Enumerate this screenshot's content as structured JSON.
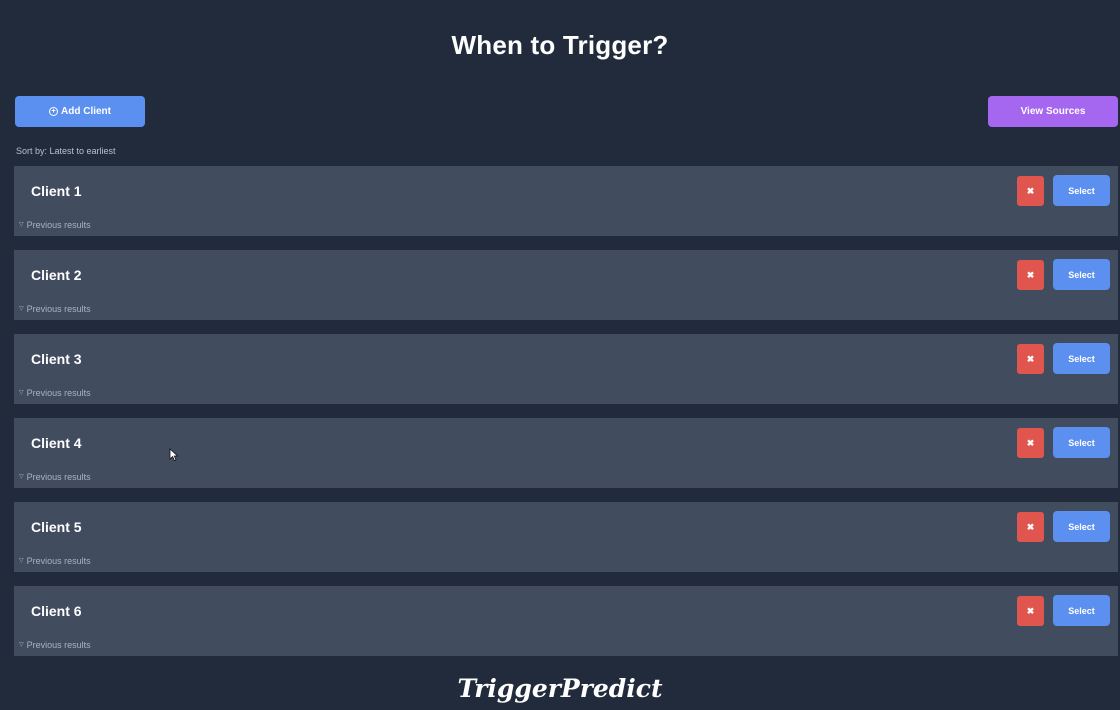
{
  "page": {
    "title": "When to Trigger?",
    "brand": "TriggerPredict"
  },
  "toolbar": {
    "add_client_label": "Add Client",
    "add_client_icon": "plus-circle-icon",
    "view_sources_label": "View Sources"
  },
  "sort": {
    "label": "Sort by: Latest to earliest"
  },
  "clients": [
    {
      "name": "Client 1",
      "results_label": "Previous results",
      "delete_glyph": "✖",
      "select_label": "Select"
    },
    {
      "name": "Client 2",
      "results_label": "Previous results",
      "delete_glyph": "✖",
      "select_label": "Select"
    },
    {
      "name": "Client 3",
      "results_label": "Previous results",
      "delete_glyph": "✖",
      "select_label": "Select"
    },
    {
      "name": "Client 4",
      "results_label": "Previous results",
      "delete_glyph": "✖",
      "select_label": "Select"
    },
    {
      "name": "Client 5",
      "results_label": "Previous results",
      "delete_glyph": "✖",
      "select_label": "Select"
    },
    {
      "name": "Client 6",
      "results_label": "Previous results",
      "delete_glyph": "✖",
      "select_label": "Select"
    }
  ],
  "colors": {
    "background": "#222b3c",
    "card": "#414c5f",
    "primary_button": "#5b8ff0",
    "sources_button": "#a566f0",
    "delete_button": "#e0564f"
  }
}
